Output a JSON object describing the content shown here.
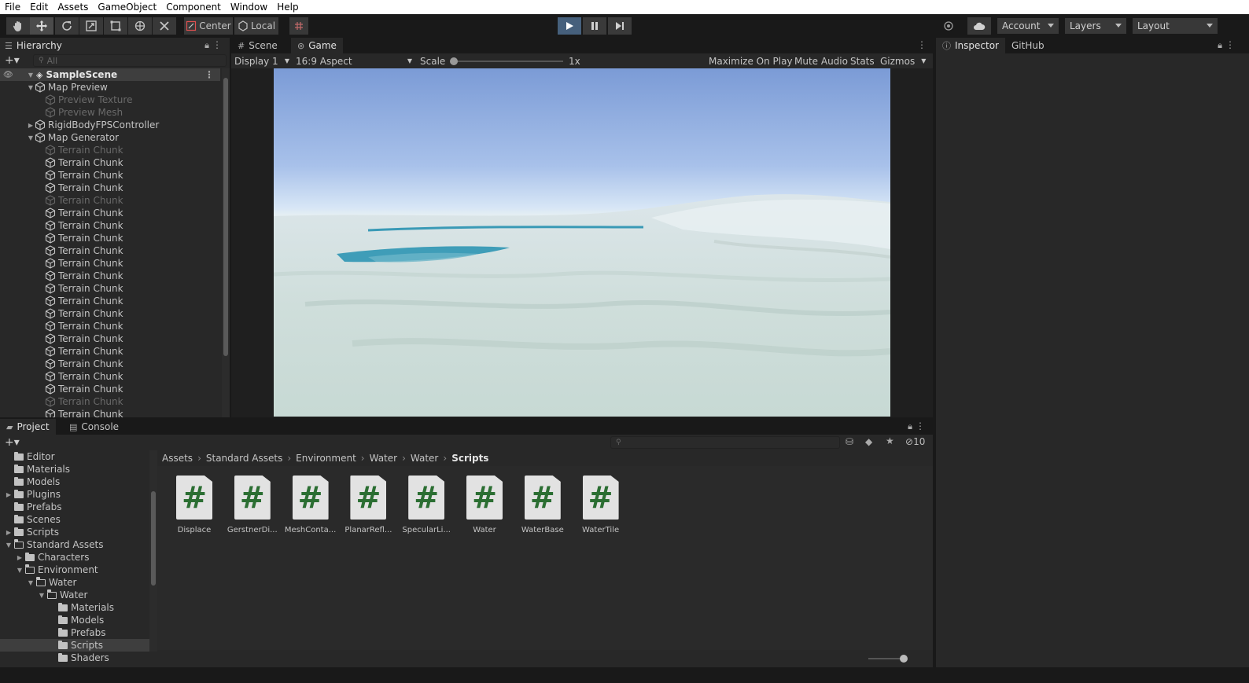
{
  "menu": [
    "File",
    "Edit",
    "Assets",
    "GameObject",
    "Component",
    "Window",
    "Help"
  ],
  "toolbar": {
    "tools": [
      "hand-icon",
      "move-icon",
      "rotate-icon",
      "scale-icon",
      "rect-icon",
      "transform-icon",
      "custom-tool-icon"
    ],
    "pivot": "Center",
    "space": "Local",
    "account": "Account",
    "layers": "Layers",
    "layout": "Layout"
  },
  "hierarchy": {
    "tab": "Hierarchy",
    "search_placeholder": "All",
    "scene": "SampleScene",
    "rows": [
      {
        "label": "Map Preview",
        "level": 1,
        "expanded": true,
        "dim": false
      },
      {
        "label": "Preview Texture",
        "level": 2,
        "dim": true
      },
      {
        "label": "Preview Mesh",
        "level": 2,
        "dim": true
      },
      {
        "label": "RigidBodyFPSController",
        "level": 1,
        "collapsed": true,
        "dim": false
      },
      {
        "label": "Map Generator",
        "level": 1,
        "expanded": true,
        "dim": false
      },
      {
        "label": "Terrain Chunk",
        "level": 2,
        "dim": true
      },
      {
        "label": "Terrain Chunk",
        "level": 2,
        "dim": false
      },
      {
        "label": "Terrain Chunk",
        "level": 2,
        "dim": false
      },
      {
        "label": "Terrain Chunk",
        "level": 2,
        "dim": false
      },
      {
        "label": "Terrain Chunk",
        "level": 2,
        "dim": true
      },
      {
        "label": "Terrain Chunk",
        "level": 2,
        "dim": false
      },
      {
        "label": "Terrain Chunk",
        "level": 2,
        "dim": false
      },
      {
        "label": "Terrain Chunk",
        "level": 2,
        "dim": false
      },
      {
        "label": "Terrain Chunk",
        "level": 2,
        "dim": false
      },
      {
        "label": "Terrain Chunk",
        "level": 2,
        "dim": false
      },
      {
        "label": "Terrain Chunk",
        "level": 2,
        "dim": false
      },
      {
        "label": "Terrain Chunk",
        "level": 2,
        "dim": false
      },
      {
        "label": "Terrain Chunk",
        "level": 2,
        "dim": false
      },
      {
        "label": "Terrain Chunk",
        "level": 2,
        "dim": false
      },
      {
        "label": "Terrain Chunk",
        "level": 2,
        "dim": false
      },
      {
        "label": "Terrain Chunk",
        "level": 2,
        "dim": false
      },
      {
        "label": "Terrain Chunk",
        "level": 2,
        "dim": false
      },
      {
        "label": "Terrain Chunk",
        "level": 2,
        "dim": false
      },
      {
        "label": "Terrain Chunk",
        "level": 2,
        "dim": false
      },
      {
        "label": "Terrain Chunk",
        "level": 2,
        "dim": false
      },
      {
        "label": "Terrain Chunk",
        "level": 2,
        "dim": true
      },
      {
        "label": "Terrain Chunk",
        "level": 2,
        "dim": false
      },
      {
        "label": "Terrain Chunk",
        "level": 2,
        "dim": false
      }
    ]
  },
  "scene_tabs": {
    "scene": "Scene",
    "game": "Game"
  },
  "game_bar": {
    "display": "Display 1",
    "aspect": "16:9 Aspect",
    "scale_label": "Scale",
    "scale_value": "1x",
    "maximize": "Maximize On Play",
    "mute": "Mute Audio",
    "stats": "Stats",
    "gizmos": "Gizmos"
  },
  "inspector": {
    "tab": "Inspector",
    "github_tab": "GitHub"
  },
  "project": {
    "tab": "Project",
    "console_tab": "Console",
    "hidden_count": "10",
    "breadcrumb": [
      "Assets",
      "Standard Assets",
      "Environment",
      "Water",
      "Water",
      "Scripts"
    ],
    "tree": [
      {
        "label": "Editor",
        "level": 2
      },
      {
        "label": "Materials",
        "level": 2
      },
      {
        "label": "Models",
        "level": 2
      },
      {
        "label": "Plugins",
        "level": 2,
        "collapsed": true
      },
      {
        "label": "Prefabs",
        "level": 2
      },
      {
        "label": "Scenes",
        "level": 2
      },
      {
        "label": "Scripts",
        "level": 2,
        "collapsed": true
      },
      {
        "label": "Standard Assets",
        "level": 2,
        "expanded": true
      },
      {
        "label": "Characters",
        "level": 3,
        "collapsed": true
      },
      {
        "label": "Environment",
        "level": 3,
        "expanded": true
      },
      {
        "label": "Water",
        "level": 4,
        "expanded": true
      },
      {
        "label": "Water",
        "level": 5,
        "expanded": true
      },
      {
        "label": "Materials",
        "level": 6
      },
      {
        "label": "Models",
        "level": 6
      },
      {
        "label": "Prefabs",
        "level": 6
      },
      {
        "label": "Scripts",
        "level": 6,
        "selected": true
      },
      {
        "label": "Shaders",
        "level": 6
      }
    ],
    "assets": [
      "Displace",
      "GerstnerDi...",
      "MeshConta...",
      "PlanarRefl...",
      "SpecularLi...",
      "Water",
      "WaterBase",
      "WaterTile"
    ]
  },
  "colors": {
    "play_active": "#46607c",
    "script_hash": "#2b6e32"
  }
}
